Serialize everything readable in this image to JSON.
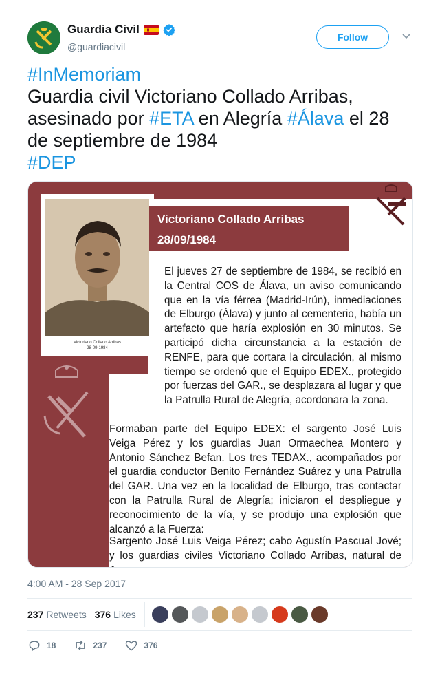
{
  "user": {
    "display_name": "Guardia Civil",
    "handle": "@guardiacivil",
    "flag_icon": "spain-flag-icon",
    "verified_icon": "verified-badge-icon"
  },
  "follow_label": "Follow",
  "tweet": {
    "hashtag1": "#InMemoriam",
    "line1": "Guardia civil Victoriano Collado Arribas,",
    "line2_a": "asesinado por ",
    "hashtag2": "#ETA",
    "line2_b": " en Alegría ",
    "hashtag3": "#Álava",
    "line2_c": " el 28",
    "line3": "de septiembre de 1984",
    "hashtag4": "#DEP"
  },
  "media": {
    "photo_caption_name": "Victoriano Collado Arribas",
    "photo_caption_date": "28-09-1984",
    "doc_title": "Victoriano Collado Arribas",
    "doc_date": "28/09/1984",
    "para1_a": "El jueves 27 de septiembre de 1984, se recibió en la Central COS de Álava, un aviso comunicando que en la vía férrea (Madrid-Irún), inmediaciones de Elburgo (Álava) y junto al cementerio, había un artefacto que haría explosión en 30 minutos. Se participó dicha circunstancia a la estación de RENFE, para que cortara la circulación, al mismo tiempo se ordenó que el Equipo EDEX., protegido por fuerzas del GAR., se desplazara al lugar y que la Patrulla Rural de Alegría, acordonara la zona.",
    "para2": "Formaban parte del Equipo EDEX: el sargento José Luis Veiga Pérez y los guardias Juan Ormaechea Montero y Antonio Sánchez Befan. Los tres TEDAX., acompañados por el guardia conductor Benito Fernández Suárez y una Patrulla del GAR. Una vez en la localidad de Elburgo, tras contactar con la Patrulla Rural de Alegría; iniciaron el despliegue y reconocimiento de la vía, y se produjo una explosión que alcanzó a la Fuerza:",
    "para3": "Sargento José Luis Veiga Pérez; cabo Agustín Pascual Jové; y los guardias civiles Victoriano Collado Arribas, natural de Arro-"
  },
  "timestamp": "4:00 AM - 28 Sep 2017",
  "stats": {
    "retweets_count": "237",
    "retweets_label": "Retweets",
    "likes_count": "376",
    "likes_label": "Likes"
  },
  "liker_avatar_colors": [
    "#3a3f5c",
    "#55585a",
    "#c5c9cf",
    "#c9a36a",
    "#d8b28a",
    "#c5c9cf",
    "#d63a1c",
    "#4a5a44",
    "#6a3a2a"
  ],
  "actions": {
    "reply_count": "18",
    "retweet_count": "237",
    "like_count": "376"
  },
  "colors": {
    "link": "#1b95e0",
    "follow": "#1da1f2",
    "muted": "#657786",
    "media_maroon": "#8c3b3e"
  }
}
